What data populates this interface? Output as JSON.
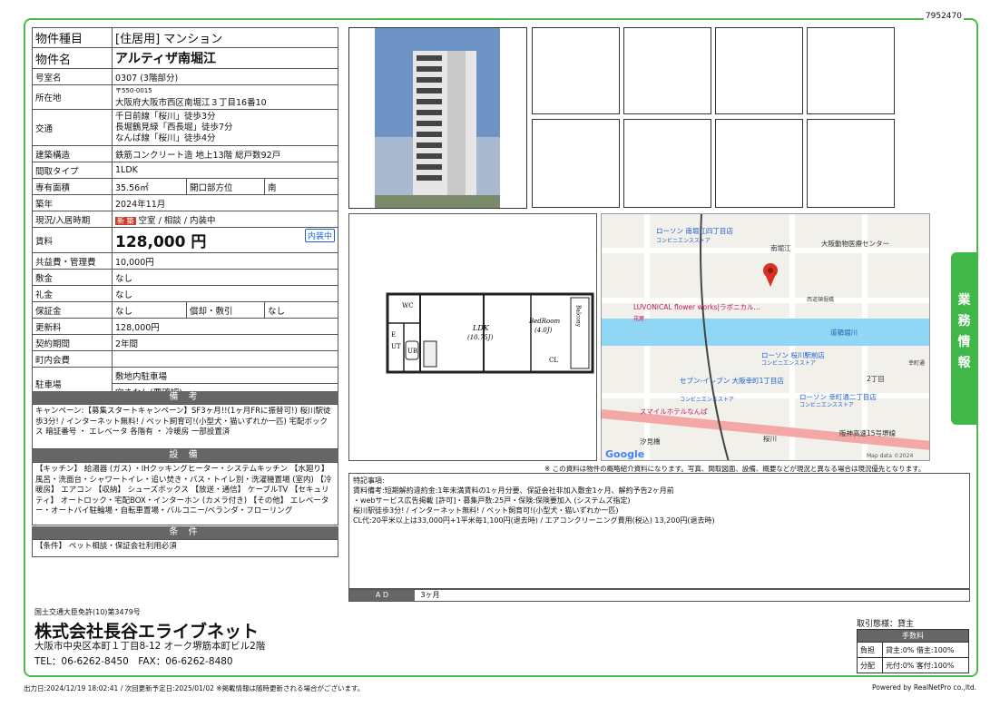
{
  "doc_id": "7952470",
  "spec": {
    "type_label": "物件種目",
    "type_value": "[住居用] マンション",
    "name_label": "物件名",
    "name_value": "アルティザ南堀江",
    "room_label": "号室名",
    "room_value": "0307 (3階部分)",
    "addr_label": "所在地",
    "addr_zip": "〒550-0015",
    "addr_value": "大阪府大阪市西区南堀江３丁目16番10",
    "access_label": "交通",
    "access_1": "千日前線「桜川」徒歩3分",
    "access_2": "長堀鶴見緑「西長堀」徒歩7分",
    "access_3": "なんば線「桜川」徒歩4分",
    "struct_label": "建築構造",
    "struct_value": "鉄筋コンクリート造 地上13階 総戸数92戸",
    "layout_label": "間取タイプ",
    "layout_value": "1LDK",
    "area_label": "専有面積",
    "area_value": "35.56㎡",
    "dir_label": "開口部方位",
    "dir_value": "南",
    "built_label": "築年",
    "built_value": "2024年11月",
    "status_label": "現況/入居時期",
    "status_badge": "新 築",
    "status_value": "空室 / 相談 / 内装中",
    "rent_label": "賃料",
    "rent_value": "128,000 円",
    "rent_tag": "内装中",
    "fee_label": "共益費・管理費",
    "fee_value": "10,000円",
    "deposit_label": "敷金",
    "deposit_value": "なし",
    "key_label": "礼金",
    "key_value": "なし",
    "hosho_label": "保証金",
    "hosho_value": "なし",
    "shokyaku_label": "償却・敷引",
    "shokyaku_value": "なし",
    "renew_label": "更新料",
    "renew_value": "128,000円",
    "term_label": "契約期間",
    "term_value": "2年間",
    "town_label": "町内会費",
    "town_value": "",
    "park_label": "駐車場",
    "park_1": "敷地内駐車場",
    "park_2": "空きなし(要確認)"
  },
  "biko": {
    "title": "備 考",
    "text": "キャンペーン:【募集スタートキャンペーン】SF3ヶ月!!(1ヶ月FRに振替可!) 桜川駅徒歩3分! / インターネット無料! / ペット飼育可!(小型犬・猫いずれか一匹) 宅配ボックス 暗証番号 ・ エレベータ 各階有 ・ 冷暖房 一部設置済"
  },
  "setsubi": {
    "title": "設 備",
    "text": "【キッチン】 給湯器 (ガス) ・IHクッキングヒーター・システムキッチン 【水廻り】 風呂・洗面台・シャワートイレ・追い焚き・バス・トイレ別・洗濯機置場 (室内) 【冷暖房】 エアコン 【収納】 シューズボックス 【放送・通信】 ケーブルTV 【セキュリティ】 オートロック・宅配BOX・インターホン (カメラ付き) 【その他】 エレベーター・オートバイ駐輪場・自転車置場・バルコニー/ベランダ・フローリング"
  },
  "joken": {
    "title": "条 件",
    "text": "【条件】 ペット相談・保証会社利用必須"
  },
  "floorplan": {
    "ldk": "LDK",
    "ldk_size": "(10.75J)",
    "bed": "BedRoom",
    "bed_size": "(4.0J)",
    "balcony": "Balcony",
    "wc": "WC",
    "e": "E",
    "ut": "UT",
    "ub": "UB",
    "cl": "CL"
  },
  "map": {
    "labels": [
      "ローソン 南堀江四丁目店",
      "コンビニエンスストア",
      "南堀江",
      "大阪動物医療センター",
      "LUVONICAL flower works|ラボニカル...",
      "花屋",
      "道頓堀川",
      "西道頓堀橋",
      "ローソン 桜川駅前店",
      "コンビニエンスストア",
      "セブン-イレブン 大阪幸町1丁目店",
      "コンビニエンスストア",
      "ローソン 幸町通二丁目店",
      "コンビニエンスストア",
      "スマイルホテルなんば",
      "汐見橋",
      "桜川",
      "阪神高速15号堺線",
      "2丁目",
      "幸町通",
      "Google",
      "Map data ©2024"
    ],
    "pin_color": "#d93025"
  },
  "disclaimer": "※ この資料は物件の概略紹介資料になります。写真、間取図面、設備、概要などが現況と異なる場合は現況優先となります。",
  "notes": {
    "title": "特記事項:",
    "line1": "賃料備考:短期解約違約金:1年未満賃料の1ヶ月分要、保証会社非加入敷金1ヶ月、解約予告2ヶ月前",
    "line2": "・webサービス広告掲載 [許可]・募集戸数:25戸・保険:保険要加入 (システムズ指定)",
    "line3": "桜川駅徒歩3分! / インターネット無料! / ペット飼育可!(小型犬・猫いずれか一匹)",
    "line4": "CL代:20平米以上は33,000円+1平米毎1,100円(退去時) / エアコンクリーニング費用(税込) 13,200円(退去時)"
  },
  "ad": {
    "label": "A D",
    "value": "3ヶ月"
  },
  "side_tab": [
    "業",
    "務",
    "情",
    "報"
  ],
  "company": {
    "license": "国土交通大臣免許(10)第3479号",
    "name": "株式会社長谷エライブネット",
    "address": "大阪市中央区本町１丁目8-12 オーク堺筋本町ビル2階",
    "tel": "TEL：06-6262-8450　FAX：06-6262-8480"
  },
  "fee_table": {
    "mode": "取引態様：貸主",
    "header": "手数料",
    "r1_label": "負担",
    "r1_value": "貸主:0% 借主:100%",
    "r2_label": "分配",
    "r2_value": "元付:0% 客付:100%"
  },
  "footer": {
    "left": "出力日:2024/12/19 18:02:41 / 次回更新予定日:2025/01/02 ※掲載情報は随時更新される場合がございます。",
    "right": "Powered by RealNetPro co.,ltd."
  }
}
